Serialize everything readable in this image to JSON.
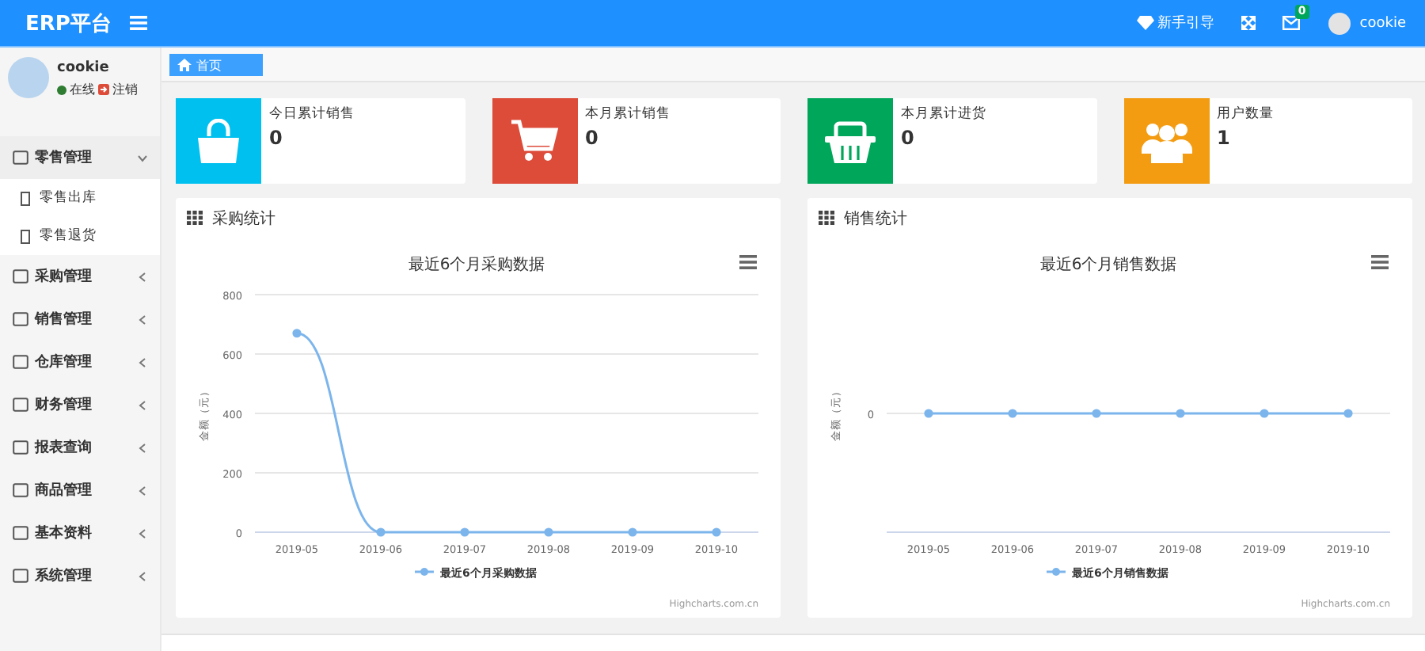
{
  "header": {
    "title": "ERP平台",
    "guide": "新手引导",
    "mail_badge": "0",
    "user": "cookie"
  },
  "sidebar": {
    "user": {
      "name": "cookie",
      "status": "在线",
      "color": "#2e7d32",
      "logout": "注销"
    },
    "items": [
      {
        "label": "零售管理",
        "expanded": true,
        "children": [
          {
            "label": "零售出库"
          },
          {
            "label": "零售退货"
          }
        ]
      },
      {
        "label": "采购管理",
        "expanded": false
      },
      {
        "label": "销售管理",
        "expanded": false
      },
      {
        "label": "仓库管理",
        "expanded": false
      },
      {
        "label": "财务管理",
        "expanded": false
      },
      {
        "label": "报表查询",
        "expanded": false
      },
      {
        "label": "商品管理",
        "expanded": false
      },
      {
        "label": "基本资料",
        "expanded": false
      },
      {
        "label": "系统管理",
        "expanded": false
      }
    ]
  },
  "tabs": [
    {
      "label": "首页",
      "selected": true
    }
  ],
  "stats": [
    {
      "kind": "bag",
      "label": "今日累计销售",
      "value": "0",
      "color": "#00c0ef"
    },
    {
      "kind": "cart",
      "label": "本月累计销售",
      "value": "0",
      "color": "#dd4b39"
    },
    {
      "kind": "basket",
      "label": "本月累计进货",
      "value": "0",
      "color": "#00a65a"
    },
    {
      "kind": "users",
      "label": "用户数量",
      "value": "1",
      "color": "#f39c12"
    }
  ],
  "panels": [
    {
      "title": "采购统计",
      "credit": "Highcharts.com.cn",
      "chart_data": {
        "type": "line",
        "title": "最近6个月采购数据",
        "ylabel": "金额（元）",
        "categories": [
          "2019-05",
          "2019-06",
          "2019-07",
          "2019-08",
          "2019-09",
          "2019-10"
        ],
        "ylim": [
          0,
          800
        ],
        "yticks": [
          0,
          200,
          400,
          600,
          800
        ],
        "grid": true,
        "series": [
          {
            "name": "最近6个月采购数据",
            "color": "#7cb5ec",
            "marker": true,
            "values": [
              670,
              0,
              0,
              0,
              0,
              0
            ]
          }
        ]
      }
    },
    {
      "title": "销售统计",
      "credit": "Highcharts.com.cn",
      "chart": {
        "title": "最近6个月销售数据",
        "ylabel": "金额（元）",
        "tick": "0",
        "categories": [
          "2019-05",
          "2019-06",
          "2019-07",
          "2019-08",
          "2019-09",
          "2019-10"
        ],
        "legend": "最近6个月销售数据"
      }
    }
  ]
}
